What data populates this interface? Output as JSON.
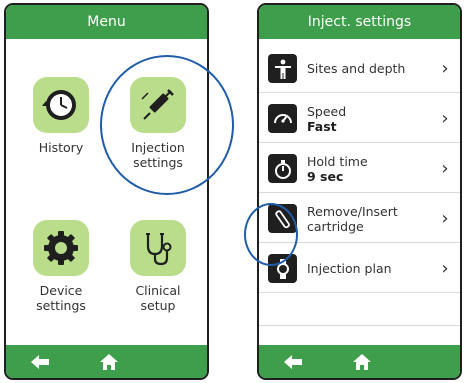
{
  "menu_screen": {
    "title": "Menu",
    "tiles": [
      {
        "label": "History"
      },
      {
        "label": "Injection settings"
      },
      {
        "label": "Device settings"
      },
      {
        "label": "Clinical setup"
      }
    ]
  },
  "settings_screen": {
    "title": "Inject. settings",
    "rows": [
      {
        "label": "Sites and depth",
        "value": ""
      },
      {
        "label": "Speed",
        "value": "Fast"
      },
      {
        "label": "Hold time",
        "value": "9 sec"
      },
      {
        "label": "Remove/Insert cartridge",
        "value": ""
      },
      {
        "label": "Injection plan",
        "value": ""
      }
    ],
    "chevron": "›"
  },
  "colors": {
    "header": "#3f9e4c",
    "tile": "#b9dd8a",
    "highlight": "#1f5da8"
  }
}
